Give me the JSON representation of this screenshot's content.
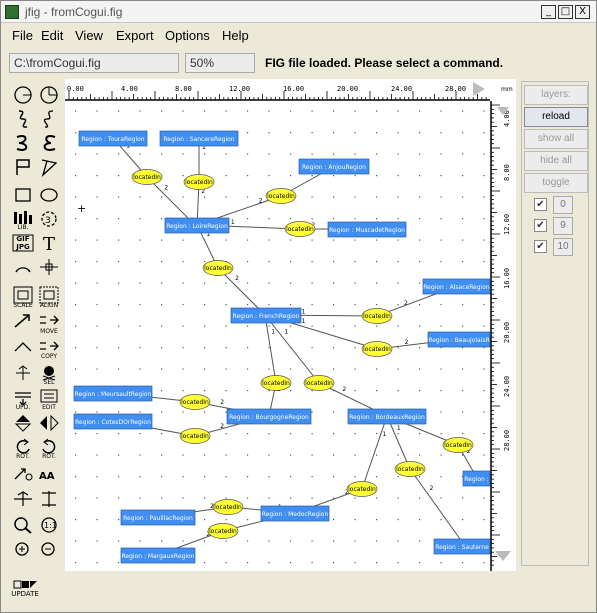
{
  "window": {
    "title": "jfig - fromCogui.fig"
  },
  "title_buttons": {
    "minimize": "_",
    "maximize": "□",
    "close": "X"
  },
  "menus": [
    "File",
    "Edit",
    "View",
    "Export",
    "Options",
    "Help"
  ],
  "toolbar": {
    "path": "C:\\fromCogui.fig",
    "zoom": "50%",
    "message": "FIG file loaded. Please select a command."
  },
  "tool_labels": {
    "lib": "LIB.",
    "gif": "GIF",
    "jpg": "JPG",
    "scale": "SCALE",
    "align": "ALIGN",
    "move": "MOVE",
    "copy": "COPY",
    "sel": "SEL",
    "upd": "UPD.",
    "edit": "EDIT",
    "rot1": "ROT.",
    "rot2": "ROT.",
    "update": "UPDATE"
  },
  "ruler": {
    "ticks": [
      "0.00",
      "4.00",
      "8.00",
      "12.00",
      "16.00",
      "20.00",
      "24.00",
      "28.00"
    ],
    "vticks": [
      "4.00",
      "8.00",
      "12.00",
      "16.00",
      "20.00",
      "24.00",
      "28.00"
    ],
    "unit": "mm"
  },
  "side_panel": {
    "layers_label": "layers:",
    "buttons": [
      "reload",
      "show all",
      "hide all",
      "toggle"
    ],
    "layers": [
      "0",
      "9",
      "10"
    ],
    "check_mark": "✔"
  },
  "diagram": {
    "relation_label": "locatedIn",
    "regions": [
      "Region : TouraRegion",
      "Region : SancereRegion",
      "Region : AnjouRegion",
      "Region : LoireRegion",
      "Region : MuscadetRegion",
      "Region : AlsaceRegion",
      "Region : FrenchRegion",
      "Region : BeaujolaisR",
      "Region : MeursaultRegion",
      "Region : CotesDOrRegion",
      "Region : BourgogneRegion",
      "Region : BordeauxRegion",
      "Region :",
      "Region : PauillacRegion",
      "Region : MedocRegion",
      "Region : MargauxRegion",
      "Region : Sauterne"
    ],
    "edge_labels": [
      "1",
      "2"
    ]
  },
  "colors": {
    "region_fill": "#3f8ef0",
    "relation_fill": "#ffff33",
    "edge": "#555555"
  }
}
